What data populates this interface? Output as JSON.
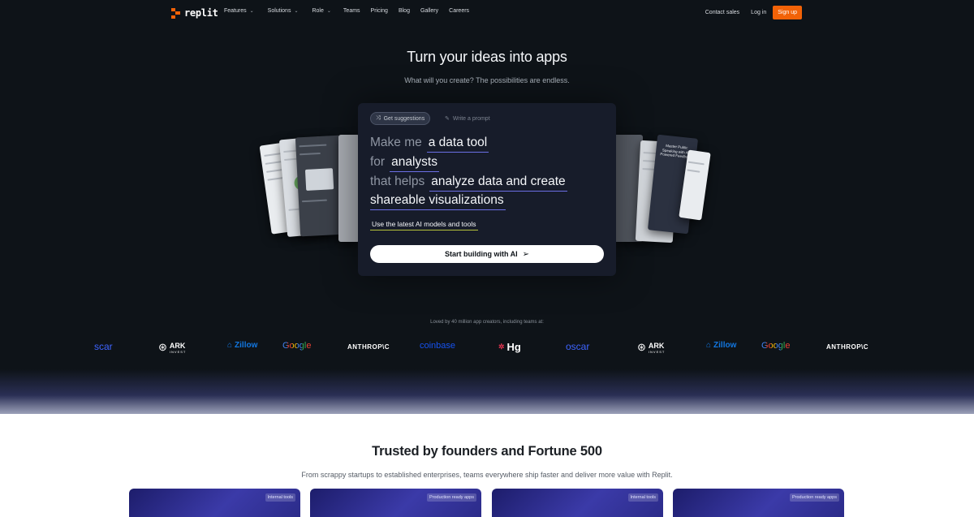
{
  "nav": {
    "logo_text": "replit",
    "links": [
      {
        "label": "Features",
        "dropdown": true
      },
      {
        "label": "Solutions",
        "dropdown": true
      },
      {
        "label": "Role",
        "dropdown": true
      },
      {
        "label": "Teams",
        "dropdown": false
      },
      {
        "label": "Pricing",
        "dropdown": false
      },
      {
        "label": "Blog",
        "dropdown": false
      },
      {
        "label": "Gallery",
        "dropdown": false
      },
      {
        "label": "Careers",
        "dropdown": false
      }
    ],
    "contact_sales": "Contact sales",
    "log_in": "Log in",
    "sign_up": "Sign up",
    "accent": "#f26207"
  },
  "hero": {
    "title": "Turn your ideas into apps",
    "subtitle": "What will you create? The possibilities are endless."
  },
  "prompt_panel": {
    "tab_suggestions": "Get suggestions",
    "tab_write": "Write a prompt",
    "line1_prefix": "Make me",
    "line1_value": "a data tool",
    "line2_prefix": "for",
    "line2_value": "analysts",
    "line3_prefix": "that helps",
    "line3_value": "analyze data and create",
    "line4_value": "shareable visualizations",
    "models_label": "Use the latest AI models and tools",
    "cta_label": "Start building with AI",
    "side_card_heading": "Master Public Speaking with AI-Powered Feedback"
  },
  "logos": {
    "caption": "Loved by 40 million app creators, including teams at:",
    "items": [
      "scar",
      "ARK",
      "Zillow",
      "Google",
      "ANTHROP\\C",
      "coinbase",
      "Hg",
      "oscar",
      "ARK",
      "Zillow",
      "Google",
      "ANTHROP\\C"
    ],
    "ark_sub": "INVEST"
  },
  "trusted": {
    "title": "Trusted by founders and Fortune 500",
    "subtitle": "From scrappy startups to established enterprises, teams everywhere ship faster and deliver more value with Replit.",
    "cards": [
      {
        "badge": "Internal tools"
      },
      {
        "badge": "Production ready apps"
      },
      {
        "badge": "Internal tools"
      },
      {
        "badge": "Production ready apps"
      }
    ]
  }
}
